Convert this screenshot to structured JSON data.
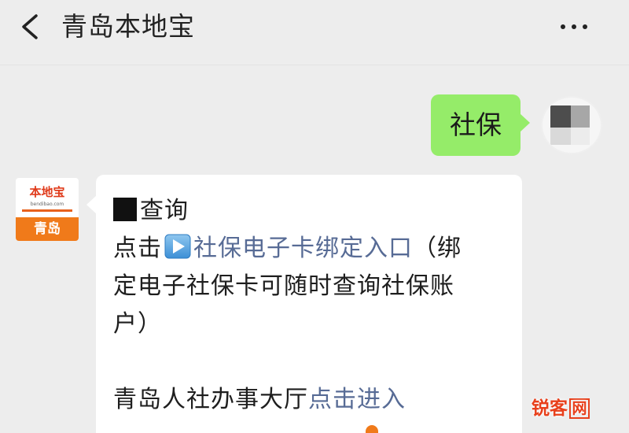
{
  "header": {
    "title": "青岛本地宝",
    "back_icon": "chevron-left-icon",
    "more_icon": "more-dots-icon"
  },
  "outgoing": {
    "text": "社保",
    "bubble_color": "#95ec69"
  },
  "sender_logo": {
    "brand": "本地宝",
    "sub": "bendibao.com",
    "city": "青岛",
    "accent": "#f07a1a"
  },
  "incoming": {
    "line1": "查询",
    "line2_prefix": "点击",
    "line2_link": "社保电子卡绑定入口",
    "line2_suffix": "（绑",
    "line3": "定电子社保卡可随时查询社保账",
    "line4": "户）",
    "line5_prefix": "青岛人社办事大厅",
    "line5_link": "点击进入",
    "link_color": "#576b95"
  },
  "watermark": {
    "text": "锐客",
    "boxed": "网"
  }
}
